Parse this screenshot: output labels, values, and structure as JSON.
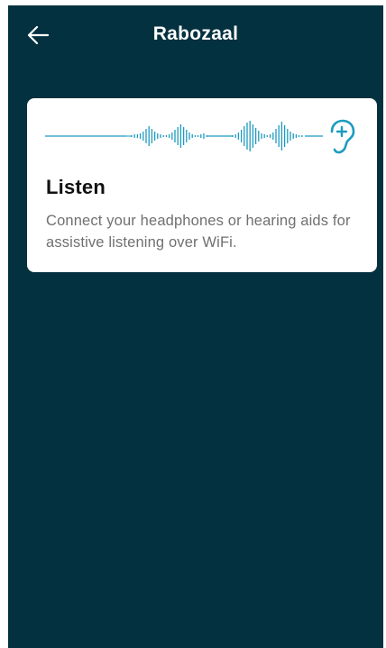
{
  "header": {
    "title": "Rabozaal",
    "back_icon": "arrow-left-icon"
  },
  "listen_card": {
    "title": "Listen",
    "description": "Connect your headphones or hearing aids for assistive listening over WiFi.",
    "waveform_icon": "audio-waveform-icon",
    "ear_icon": "hearing-assist-ear-icon",
    "accent_color": "#1c9bbf"
  },
  "colors": {
    "background": "#04313f",
    "card": "#ffffff",
    "title_text": "#ffffff",
    "description_text": "#707070"
  }
}
